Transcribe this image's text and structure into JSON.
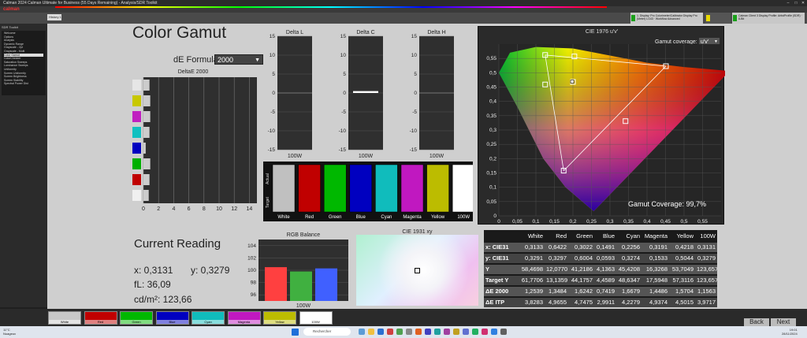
{
  "window": {
    "title": "Calman 2024 Calman Ultimate for Business (55 Days Remaining) - Analysis/SDR Toolkit",
    "brand": "calman",
    "menu": "File  Edit  View  Help",
    "minimize": "–",
    "maximize": "□",
    "close": "✕"
  },
  "history_tab": "History 1",
  "devices": [
    {
      "text": "1. Display: Pro Colorimeter/Calibrator Display Pro (Meter) LG43 · Workflow Advanced",
      "color": "#1aa01a"
    },
    {
      "text": "",
      "color": "#e8d800"
    },
    {
      "text": "Calman Client 3 Display Profile: ArtistProfile (SDR) · 8-Bit",
      "color": "#1aa01a"
    }
  ],
  "sidebar": {
    "header": "SDR Toolkit",
    "items": [
      "Welcome",
      "Options",
      "Analysis",
      "Dynamic Range",
      "Grayscale - 2pt",
      "Grayscale - Multi",
      "Color Gamut",
      "ColorChecker",
      "Saturation Sweeps",
      "Luminance Sweeps",
      "Uniformity",
      "Screen Uniformity",
      "Screen Brightness",
      "Screen Stability",
      "Spectral Power Dist"
    ],
    "selected": 6
  },
  "page_title": "Color Gamut",
  "de_formula": {
    "label": "dE Formula:",
    "value": "2000"
  },
  "deltaE": {
    "title": "DeltaE 2000",
    "ticks": [
      "0",
      "2",
      "4",
      "6",
      "8",
      "10",
      "12",
      "14"
    ],
    "bars": [
      {
        "color": "#e6e6e6",
        "value": 0.8
      },
      {
        "color": "#c8c800",
        "value": 0.9
      },
      {
        "color": "#c020c0",
        "value": 0.9
      },
      {
        "color": "#10c0c0",
        "value": 0.8
      },
      {
        "color": "#0000c0",
        "value": 0.3
      },
      {
        "color": "#00b000",
        "value": 0.9
      },
      {
        "color": "#c00000",
        "value": 0.8
      },
      {
        "color": "#f0f0f0",
        "value": 0.7
      }
    ]
  },
  "delta_plots": [
    {
      "title": "Delta L",
      "label": "100W",
      "value": 0
    },
    {
      "title": "Delta C",
      "label": "100W",
      "value": 0.5
    },
    {
      "title": "Delta H",
      "label": "100W",
      "value": 0
    }
  ],
  "delta_ticks": [
    "15",
    "10",
    "5",
    "0",
    "-5",
    "-10",
    "-15"
  ],
  "swatches": {
    "row_label_top": "Actual",
    "row_label_bottom": "Target",
    "items": [
      {
        "label": "White",
        "color": "#c0c0c0"
      },
      {
        "label": "Red",
        "color": "#c00000"
      },
      {
        "label": "Green",
        "color": "#00b800"
      },
      {
        "label": "Blue",
        "color": "#0000c0"
      },
      {
        "label": "Cyan",
        "color": "#10bcbc"
      },
      {
        "label": "Magenta",
        "color": "#c018c0"
      },
      {
        "label": "Yellow",
        "color": "#bcbc00"
      },
      {
        "label": "100W",
        "color": "#ffffff"
      }
    ]
  },
  "current_reading": {
    "title": "Current Reading",
    "x": "x: 0,3131",
    "y": "y: 0,3279",
    "fl": "fL: 36,09",
    "cdm": "cd/m²: 123,66"
  },
  "rgb_balance": {
    "title": "RGB Balance",
    "label": "100W",
    "ticks": [
      "104",
      "102",
      "100",
      "98",
      "96"
    ],
    "ymin": 95,
    "ymax": 105,
    "bars": [
      {
        "color": "#ff4040",
        "value": 100.5
      },
      {
        "color": "#40b040",
        "value": 99.8
      },
      {
        "color": "#4060ff",
        "value": 100.3
      }
    ]
  },
  "cie1931": {
    "title": "CIE 1931 xy"
  },
  "gamut": {
    "title": "CIE 1976 u'v'",
    "coverage_label": "Gamut coverage:",
    "coverage_select": "u'v'",
    "coverage_text": "Gamut Coverage:  99,7%",
    "yticks": [
      "0,55",
      "0,5",
      "0,45",
      "0,4",
      "0,35",
      "0,3",
      "0,25",
      "0,2",
      "0,15",
      "0,1",
      "0,05",
      "0"
    ],
    "xticks": [
      "0",
      "0,05",
      "0,1",
      "0,15",
      "0,2",
      "0,25",
      "0,3",
      "0,35",
      "0,4",
      "0,45",
      "0,5",
      "0,55"
    ],
    "targets": [
      [
        0.451,
        0.523
      ],
      [
        0.125,
        0.562
      ],
      [
        0.175,
        0.158
      ],
      [
        0.2,
        0.468
      ],
      [
        0.125,
        0.459
      ],
      [
        0.342,
        0.331
      ],
      [
        0.204,
        0.557
      ]
    ],
    "measured": [
      [
        0.198,
        0.469
      ]
    ]
  },
  "table": {
    "headers": [
      "",
      "White",
      "Red",
      "Green",
      "Blue",
      "Cyan",
      "Magenta",
      "Yellow",
      "100W"
    ],
    "rows": [
      [
        "x: CIE31",
        "0,3133",
        "0,6422",
        "0,3022",
        "0,1491",
        "0,2256",
        "0,3191",
        "0,4218",
        "0,3131"
      ],
      [
        "y: CIE31",
        "0,3291",
        "0,3297",
        "0,6004",
        "0,0593",
        "0,3274",
        "0,1533",
        "0,5044",
        "0,3279"
      ],
      [
        "Y",
        "58,4698",
        "12,0770",
        "41,2186",
        "4,1363",
        "45,4208",
        "16,3268",
        "53,7049",
        "123,657"
      ],
      [
        "Target Y",
        "61,7706",
        "13,1359",
        "44,1757",
        "4,4589",
        "48,6347",
        "17,5948",
        "57,3116",
        "123,657"
      ],
      [
        "ΔE 2000",
        "1,2539",
        "1,3484",
        "1,6242",
        "0,7419",
        "1,6679",
        "1,4486",
        "1,5704",
        "1,1563"
      ],
      [
        "ΔE ITP",
        "3,8283",
        "4,9655",
        "4,7475",
        "2,9911",
        "4,2279",
        "4,9374",
        "4,5015",
        "3,9717"
      ]
    ]
  },
  "bottom": {
    "swatches": [
      {
        "label": "White",
        "color": "#c8c8c8"
      },
      {
        "label": "Red",
        "color": "#c00000"
      },
      {
        "label": "Green",
        "color": "#00b800"
      },
      {
        "label": "Blue",
        "color": "#0000c0"
      },
      {
        "label": "Cyan",
        "color": "#10bcbc"
      },
      {
        "label": "Magenta",
        "color": "#c018c0"
      },
      {
        "label": "Yellow",
        "color": "#bcbc00"
      },
      {
        "label": "100W",
        "color": "#ffffff"
      }
    ],
    "back": "Back",
    "next": "Next"
  },
  "taskbar": {
    "weather": "11°C\nNuageux",
    "search": "Rechercher",
    "time": "19:01",
    "date": "28/11/2024"
  }
}
